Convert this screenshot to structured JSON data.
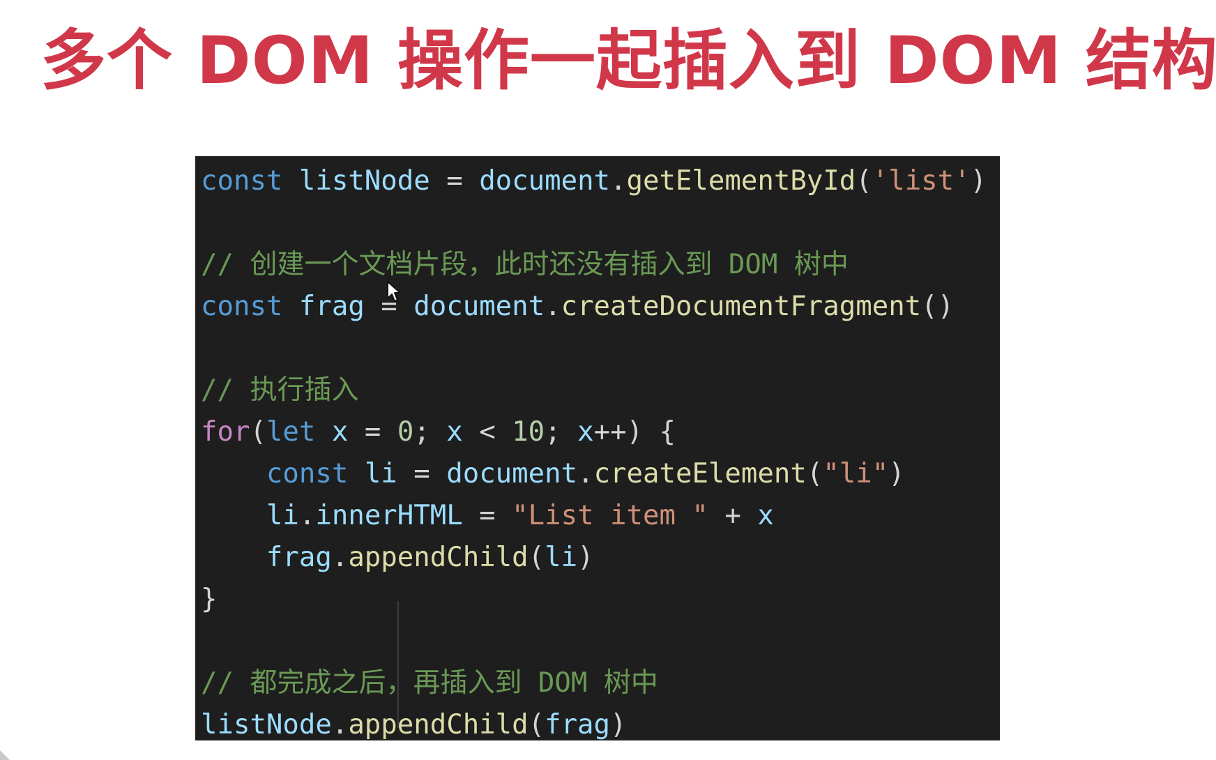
{
  "title": "多个 DOM 操作一起插入到 DOM 结构",
  "colors": {
    "title": "#d0384a",
    "editor_background": "#1e1e1e",
    "keyword": "#569cd6",
    "control_keyword": "#c586c0",
    "variable": "#9cdcfe",
    "function": "#dcdcaa",
    "string": "#ce9178",
    "number": "#b5cea8",
    "comment": "#6a9955",
    "punctuation": "#d4d4d4"
  },
  "icons": {
    "cursor": "mouse-pointer-arrow-icon"
  },
  "code": {
    "line1": {
      "kw": "const",
      "var": "listNode",
      "eq": " = ",
      "obj": "document",
      "dot": ".",
      "fn": "getElementById",
      "open": "(",
      "str": "'list'",
      "close": ")"
    },
    "line3": {
      "comment": "// 创建一个文档片段，此时还没有插入到 DOM 树中"
    },
    "line4": {
      "kw": "const",
      "var": "frag",
      "eq": " = ",
      "obj": "document",
      "dot": ".",
      "fn": "createDocumentFragment",
      "parens": "()"
    },
    "line6": {
      "comment": "// 执行插入"
    },
    "line7": {
      "for": "for",
      "open": "(",
      "let": "let",
      "x1": "x",
      "eq": " = ",
      "zero": "0",
      "semi1": "; ",
      "x2": "x",
      "lt": " < ",
      "ten": "10",
      "semi2": "; ",
      "x3": "x",
      "inc": "++",
      "close": ") {"
    },
    "line8": {
      "kw": "const",
      "var": "li",
      "eq": " = ",
      "obj": "document",
      "dot": ".",
      "fn": "createElement",
      "open": "(",
      "str": "\"li\"",
      "close": ")"
    },
    "line9": {
      "obj": "li",
      "dot": ".",
      "prop": "innerHTML",
      "eq": " = ",
      "str": "\"List item \"",
      "plus": " + ",
      "x": "x"
    },
    "line10": {
      "obj": "frag",
      "dot": ".",
      "fn": "appendChild",
      "open": "(",
      "arg": "li",
      "close": ")"
    },
    "line11": {
      "brace": "}"
    },
    "line13": {
      "comment": "// 都完成之后，再插入到 DOM 树中"
    },
    "line14": {
      "obj": "listNode",
      "dot": ".",
      "fn": "appendChild",
      "open": "(",
      "arg": "frag",
      "close": ")"
    }
  }
}
